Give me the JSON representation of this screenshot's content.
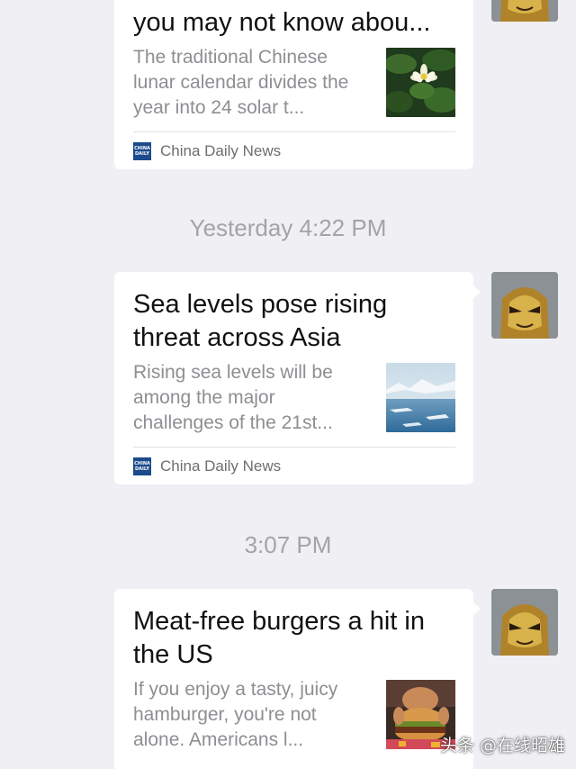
{
  "messages": [
    {
      "title_line1": "you may not know abou...",
      "summary": "The traditional Chinese lunar calendar divides the year into 24 solar t...",
      "source": "China Daily News",
      "thumbnail": "lotus-flower-image"
    },
    {
      "timestamp": "Yesterday 4:22 PM",
      "title_line1": "Sea levels pose rising",
      "title_line2": "threat across Asia",
      "summary": "Rising sea levels will be among the major challenges of the 21st...",
      "source": "China Daily News",
      "thumbnail": "glacier-sea-image"
    },
    {
      "timestamp": "3:07 PM",
      "title_line1": "Meat-free burgers a hit in",
      "title_line2": "the US",
      "summary": "If you enjoy a tasty, juicy hamburger, you're not alone. Americans l...",
      "thumbnail": "burger-image"
    }
  ],
  "source_logo_text": "CHINA DAILY",
  "watermark": "头条 @在线昭雄",
  "colors": {
    "background": "#efeff4",
    "card": "#ffffff",
    "title": "#111111",
    "summary": "#8e8e93",
    "timestamp": "#a3a3a8",
    "source_logo": "#1c4a8c"
  }
}
